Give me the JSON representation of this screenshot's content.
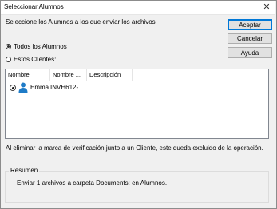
{
  "window": {
    "title": "Seleccionar Alumnos",
    "close_glyph": "✕"
  },
  "main": {
    "instruction": "Seleccione los Alumnos a los que enviar los archivos",
    "radio_all": {
      "label": "Todos los Alumnos",
      "checked": true
    },
    "radio_clients": {
      "label": "Estos Clientes:",
      "checked": false
    }
  },
  "buttons": {
    "accept": "Aceptar",
    "cancel": "Cancelar",
    "help": "Ayuda"
  },
  "list": {
    "columns": [
      "Nombre",
      "Nombre ...",
      "Descripción"
    ],
    "rows": [
      {
        "name": "Emma",
        "machine": "INVH612-...",
        "description": "",
        "selected": true,
        "icon": "user-icon"
      }
    ]
  },
  "note": "Al eliminar la marca de verificación junto a un Cliente, este queda excluido de la operación.",
  "summary": {
    "legend": "Resumen",
    "text": "Enviar 1 archivos a carpeta Documents: en Alumnos."
  },
  "colors": {
    "accent": "#0078d7",
    "user_icon": "#1e7bc7"
  }
}
